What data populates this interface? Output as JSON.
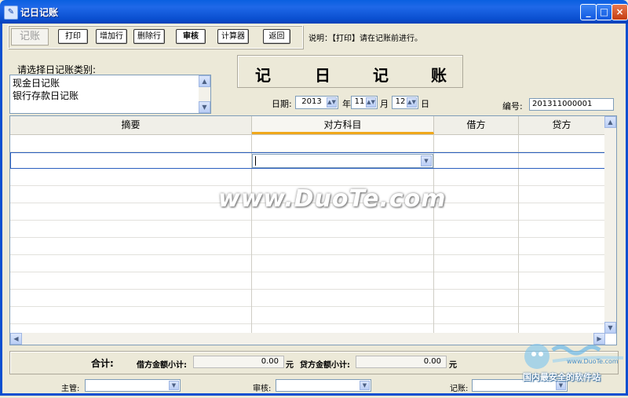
{
  "window": {
    "title": "记日记账",
    "icon": "ledger-icon",
    "controls": {
      "minimize": "_",
      "maximize": "□",
      "close": "×"
    }
  },
  "toolbar": {
    "jizhang_label": "记账",
    "buttons": [
      "打印",
      "增加行",
      "删除行",
      "审核",
      "计算器",
      "返回"
    ],
    "note": "说明：【打印】请在记账前进行。"
  },
  "category": {
    "label": "请选择日记账类别:",
    "items": [
      "现金日记账",
      "银行存款日记账"
    ]
  },
  "banner": {
    "chars": [
      "记",
      "日",
      "记",
      "账"
    ]
  },
  "date": {
    "label": "日期:",
    "year": "2013",
    "year_unit": "年",
    "month": "11",
    "month_unit": "月",
    "day": "12",
    "day_unit": "日"
  },
  "number": {
    "label": "编号:",
    "value": "201311000001"
  },
  "grid": {
    "columns": [
      "摘要",
      "对方科目",
      "借方",
      "贷方"
    ]
  },
  "totals": {
    "label": "合计:",
    "debit_label": "借方金额小计:",
    "debit_value": "0.00",
    "debit_unit": "元",
    "credit_label": "贷方金额小计:",
    "credit_value": "0.00",
    "credit_unit": "元"
  },
  "bottom": {
    "supervisor_label": "主管:",
    "review_label": "审核:",
    "bookkeeper_label": "记账:"
  },
  "watermark": "www.DuoTe.com",
  "logo": {
    "text": "国内最安全的软件站",
    "url": "www.DuoTe.com"
  },
  "colors": {
    "titlebar": "#0a5fe0",
    "active_header": "#f0a81c",
    "window_bg": "#ece9d8"
  }
}
